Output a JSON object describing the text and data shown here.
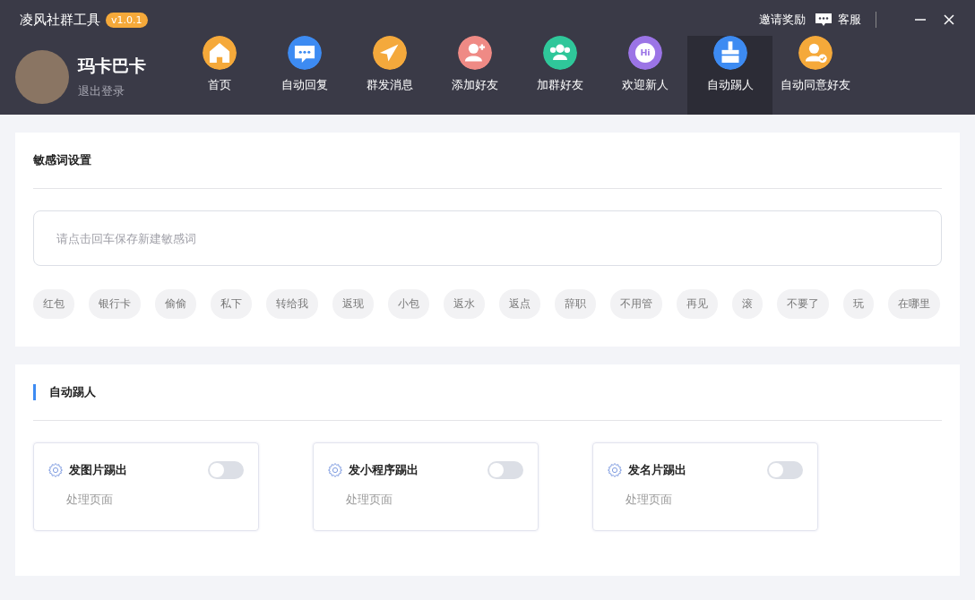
{
  "app": {
    "title": "凌风社群工具",
    "version": "v1.0.1"
  },
  "header_links": {
    "invite": "邀请奖励",
    "support": "客服"
  },
  "user": {
    "name": "玛卡巴卡",
    "logout": "退出登录"
  },
  "nav": [
    {
      "label": "首页",
      "kind": "home",
      "color": "#f5a93a",
      "selected": false
    },
    {
      "label": "自动回复",
      "kind": "chat",
      "color": "#3d8bf2",
      "selected": false
    },
    {
      "label": "群发消息",
      "kind": "send",
      "color": "#f4a93c",
      "selected": false
    },
    {
      "label": "添加好友",
      "kind": "add-user",
      "color": "#ef8a85",
      "selected": false
    },
    {
      "label": "加群好友",
      "kind": "group",
      "color": "#2fc79a",
      "selected": false
    },
    {
      "label": "欢迎新人",
      "kind": "hi",
      "icon_text": "Hi",
      "color": "#9b74e6",
      "selected": false
    },
    {
      "label": "自动踢人",
      "kind": "broom",
      "color": "#3d8bf2",
      "selected": true
    },
    {
      "label": "自动同意好友",
      "kind": "user-check",
      "color": "#f5a93a",
      "selected": false
    }
  ],
  "sensitive_words": {
    "title": "敏感词设置",
    "placeholder": "请点击回车保存新建敏感词",
    "tags": [
      "红包",
      "银行卡",
      "偷偷",
      "私下",
      "转给我",
      "返现",
      "小包",
      "返水",
      "返点",
      "辞职",
      "不用管",
      "再见",
      "滚",
      "不要了",
      "玩",
      "在哪里"
    ]
  },
  "auto_kick": {
    "title": "自动踢人",
    "rules": [
      {
        "title": "发图片踢出",
        "link": "处理页面",
        "on": false
      },
      {
        "title": "发小程序踢出",
        "link": "处理页面",
        "on": false
      },
      {
        "title": "发名片踢出",
        "link": "处理页面",
        "on": false
      }
    ]
  }
}
